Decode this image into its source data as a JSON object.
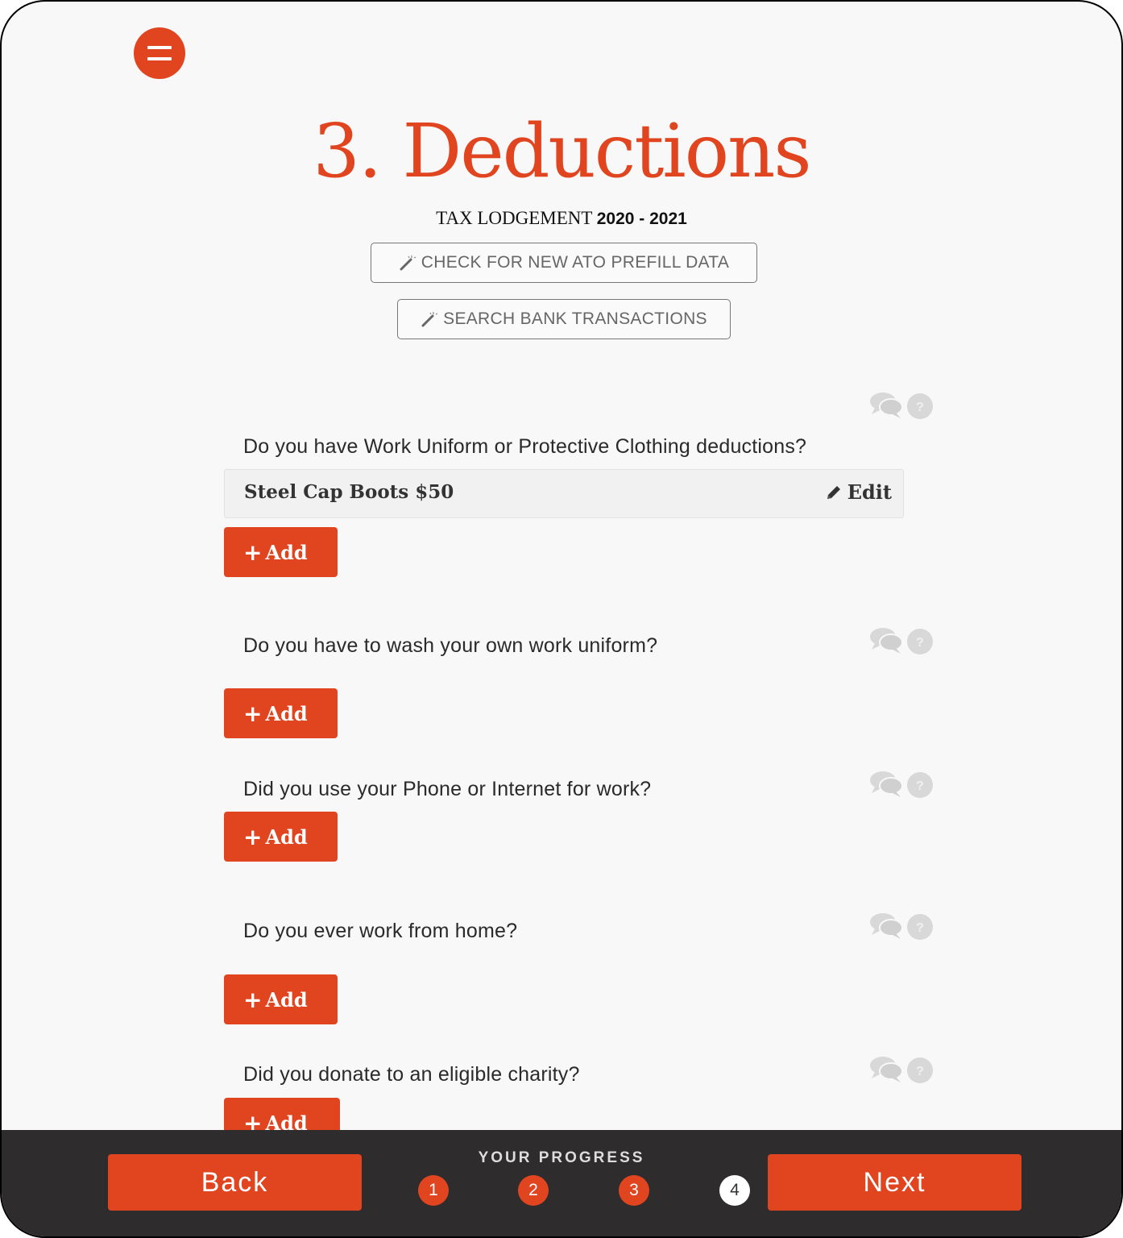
{
  "header": {
    "menu_icon": "hamburger-menu-icon",
    "title": "3. Deductions",
    "subtitle_prefix": "TAX LODGEMENT",
    "subtitle_year": "2020 - 2021"
  },
  "actions": {
    "prefill_label": "CHECK FOR NEW ATO PREFILL DATA",
    "bank_label": "SEARCH BANK TRANSACTIONS",
    "icon": "magic-wand-icon"
  },
  "questions": [
    {
      "text": "Do you have Work Uniform or Protective Clothing deductions?",
      "entries": [
        {
          "label": "Steel Cap Boots $50",
          "edit_label": "Edit"
        }
      ],
      "add_label": "Add"
    },
    {
      "text": "Do you have to wash your own work uniform?",
      "entries": [],
      "add_label": "Add"
    },
    {
      "text": "Did you use your Phone or Internet for work?",
      "entries": [],
      "add_label": "Add"
    },
    {
      "text": "Do you ever work from home?",
      "entries": [],
      "add_label": "Add"
    },
    {
      "text": "Did you donate to an eligible charity?",
      "entries": [],
      "add_label": "Add"
    }
  ],
  "help_icons": {
    "chat": "chat-bubbles-icon",
    "help": "question-circle-icon",
    "help_glyph": "?"
  },
  "footer": {
    "back_label": "Back",
    "next_label": "Next",
    "progress_label": "YOUR PROGRESS",
    "steps": [
      {
        "number": "1",
        "state": "done"
      },
      {
        "number": "2",
        "state": "done"
      },
      {
        "number": "3",
        "state": "done"
      },
      {
        "number": "4",
        "state": "current"
      }
    ],
    "current_step": 4,
    "total_steps": 4
  },
  "colors": {
    "accent": "#e04520",
    "footer_bg": "#2e2c2c",
    "page_bg": "#f8f8f8"
  }
}
